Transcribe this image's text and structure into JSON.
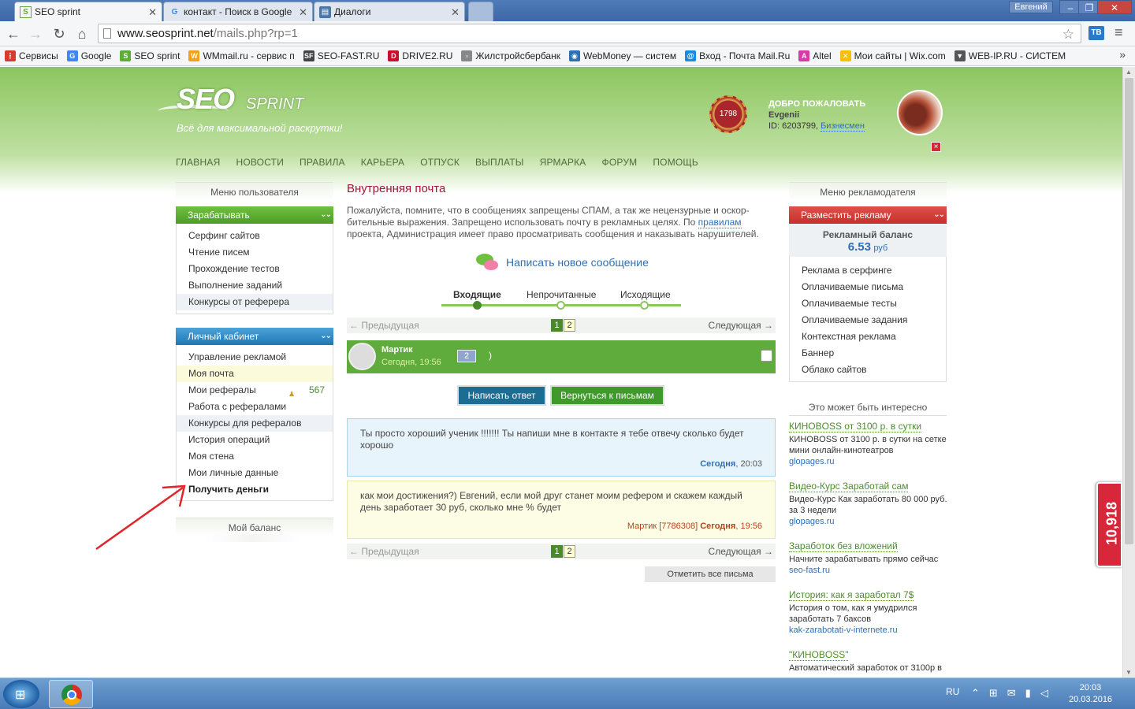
{
  "browser": {
    "tabs": [
      {
        "title": "SEO sprint",
        "icon": "seosprint-favicon"
      },
      {
        "title": "контакт - Поиск в Google",
        "icon": "google-favicon"
      },
      {
        "title": "Диалоги",
        "icon": "vk-favicon"
      },
      {
        "title": "",
        "icon": "new-tab"
      }
    ],
    "user_badge": "Евгений",
    "url_host": "www.seosprint.net",
    "url_path": "/mails.php?rp=1",
    "extension_label": "ТВ",
    "bookmarks": [
      {
        "label": "Сервисы",
        "icon": "apps-icon",
        "color": "#d23f31"
      },
      {
        "label": "Google",
        "icon": "google-icon",
        "color": "#4285f4"
      },
      {
        "label": "SEO sprint",
        "icon": "seosprint-icon",
        "color": "#5fab3b"
      },
      {
        "label": "WMmail.ru - сервис п",
        "icon": "wmmail-icon",
        "color": "#f0a020"
      },
      {
        "label": "SEO-FAST.RU",
        "icon": "seofast-icon",
        "color": "#444"
      },
      {
        "label": "DRIVE2.RU",
        "icon": "drive2-icon",
        "color": "#c8102e"
      },
      {
        "label": "Жилстройсбербанк",
        "icon": "page-icon",
        "color": "#888"
      },
      {
        "label": "WebMoney — систем",
        "icon": "webmoney-icon",
        "color": "#2e6fb5"
      },
      {
        "label": "Вход - Почта Mail.Ru",
        "icon": "mailru-icon",
        "color": "#168de2"
      },
      {
        "label": "Altel",
        "icon": "altel-icon",
        "color": "#d93aa6"
      },
      {
        "label": "Мои сайты | Wix.com",
        "icon": "wix-icon",
        "color": "#f6c000"
      },
      {
        "label": "WEB-IP.RU - СИСТЕМ",
        "icon": "webip-icon",
        "color": "#555"
      }
    ]
  },
  "site": {
    "logo_main": "SEO",
    "logo_sub": "SPRINT",
    "tagline": "Всё для максимальной раскрутки!",
    "rating": "1798",
    "welcome": "ДОБРО ПОЖАЛОВАТЬ",
    "username": "Evgenii",
    "user_id": "ID: 6203799,",
    "status": "Бизнесмен",
    "close_x": "×",
    "nav": [
      "ГЛАВНАЯ",
      "НОВОСТИ",
      "ПРАВИЛА",
      "КАРЬЕРА",
      "ОТПУСК",
      "ВЫПЛАТЫ",
      "ЯРМАРКА",
      "ФОРУМ",
      "ПОМОЩЬ"
    ]
  },
  "left": {
    "menu_title": "Меню пользователя",
    "earn_title": "Зарабатывать",
    "earn_items": [
      "Серфинг сайтов",
      "Чтение писем",
      "Прохождение тестов",
      "Выполнение заданий",
      "Конкурсы от реферера"
    ],
    "cabinet_title": "Личный кабинет",
    "cabinet_items": [
      "Управление рекламой",
      "Моя почта",
      "Мои рефералы",
      "Работа с рефералами",
      "Конкурсы для рефералов",
      "История операций",
      "Моя стена",
      "Мои личные данные",
      "Получить деньги"
    ],
    "referrals_count": "567",
    "balance_title": "Мой баланс"
  },
  "center": {
    "title": "Внутренняя почта",
    "warning": "Пожалуйста, помните, что в сообщениях запрещены СПАМ, а так же нецензурные и оскор-бительные выражения. Запрещено использовать почту в рекламных целях. По",
    "warning_link": "правилам",
    "warning_tail": "проекта, Администрация имеет право просматривать сообщения и наказывать нарушителей.",
    "write_new": "Написать новое сообщение",
    "tabs": [
      "Входящие",
      "Непрочитанные",
      "Исходящие"
    ],
    "pager": {
      "prev": "← Предыдущая",
      "next": "Следующая →",
      "pages": [
        "1",
        "2"
      ]
    },
    "thread": {
      "sender": "Мартик",
      "date": "Сегодня, 19:56",
      "count": "2",
      "subject": ")"
    },
    "reply_button": "Написать ответ",
    "back_button": "Вернуться к письмам",
    "messages": [
      {
        "text": "Ты просто хороший ученик !!!!!!! Ты напиши мне в контакте я тебе отвечу сколько будет хорошо",
        "who": "Сегодня",
        "time": ", 20:03"
      },
      {
        "text": "как мои достижения?) Евгений, если мой друг станет моим рефером и скажем каждый день заработает 30 руб, сколько мне % будет",
        "who": "Мартик [7786308]",
        "when": "Сегодня",
        "time": ", 19:56"
      }
    ],
    "mark_all": "Отметить все письма"
  },
  "right": {
    "menu_title": "Меню рекламодателя",
    "place_ad": "Разместить рекламу",
    "balance_label": "Рекламный баланс",
    "balance_value": "6.53",
    "balance_currency": "руб",
    "items": [
      "Реклама в серфинге",
      "Оплачиваемые письма",
      "Оплачиваемые тесты",
      "Оплачиваемые задания",
      "Контекстная реклама",
      "Баннер",
      "Облако сайтов"
    ],
    "interest_title": "Это может быть интересно",
    "ads": [
      {
        "title": "КИНОBOSS от 3100 р. в сутки",
        "text": "КИНОBOSS от 3100 р. в сутки на сетке мини онлайн-кинотеатров",
        "url": "glopages.ru"
      },
      {
        "title": "Видео-Курс Заработай сам",
        "text": "Видео-Курс Как заработать 80 000 руб. за 3 недели",
        "url": "glopages.ru"
      },
      {
        "title": "Заработок без вложений",
        "text": "Начните зарабатывать прямо сейчас",
        "url": "seo-fast.ru"
      },
      {
        "title": "История: как я заработал 7$",
        "text": "История о том, как я умудрился заработать 7 баксов",
        "url": "kak-zarabotati-v-internete.ru"
      },
      {
        "title": "\"КИНОBOSS\"",
        "text": "Автоматический заработок от 3100р в",
        "url": ""
      }
    ],
    "widget_value": "10,918"
  },
  "taskbar": {
    "lang": "RU",
    "time": "20:03",
    "date": "20.03.2016"
  },
  "colors": {
    "header_green": "#8cc65f",
    "accent_blue": "#2e6fb5",
    "title_red": "#a8143a",
    "annotation_arrow": "#e0262a"
  }
}
